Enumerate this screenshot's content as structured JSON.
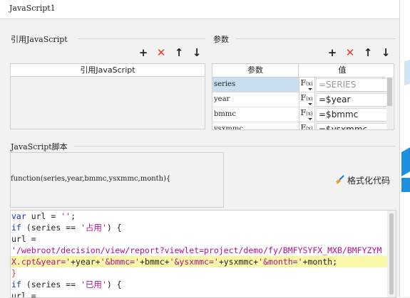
{
  "window": {
    "title": "JavaScript1"
  },
  "ref_js": {
    "section_title": "引用JavaScript",
    "column_header": "引用JavaScript",
    "toolbar": {
      "add": "+",
      "remove": "✕",
      "up": "↑",
      "down": "↓"
    }
  },
  "params": {
    "section_title": "参数",
    "toolbar": {
      "add": "+",
      "remove": "✕",
      "up": "↑",
      "down": "↓"
    },
    "col_name": "参数",
    "col_value": "值",
    "fx_label": "F",
    "fx_sub": "(x)",
    "rows": [
      {
        "name": "series",
        "value": "=SERIES",
        "selected": true
      },
      {
        "name": "year",
        "value": "=$year"
      },
      {
        "name": "bmmc",
        "value": "=$bmmc"
      },
      {
        "name": "ysxmmc",
        "value": "=$ysxmmc"
      }
    ]
  },
  "script": {
    "section_title": "JavaScript脚本",
    "function_signature": "function(series,year,bmmc,ysxmmc,month){",
    "format_button": "格式化代码",
    "code": {
      "l1_kw": "var",
      "l1_rest": " url = ",
      "l1_str": "''",
      "l1_end": ";",
      "l2_kw": "if",
      "l2_rest": " (series == ",
      "l2_str": "'占用'",
      "l2_end": ") {",
      "l3": "url =",
      "l4_str": "'/webroot/decision/view/report?viewlet=project/demo/fy/BMFYSYFX_MXB/BMFYZYM",
      "l5_str1": "X.cpt&year='",
      "l5_a": "+year+",
      "l5_str2": "'&bmmc='",
      "l5_b": "+bmmc+",
      "l5_str3": "'&ysxmmc='",
      "l5_c": "+ysxmmc+",
      "l5_str4": "'&month='",
      "l5_d": "+month;",
      "l6": "}",
      "l7_kw": "if",
      "l7_rest": " (series == ",
      "l7_str": "'已用'",
      "l7_end": ") {",
      "l8": "url ="
    }
  },
  "colors": {
    "accent_red": "#e23b2e",
    "keyword": "#1b33b8",
    "string": "#b0108e",
    "highlight": "#fbf7a8",
    "selected_row": "#c9deee"
  }
}
